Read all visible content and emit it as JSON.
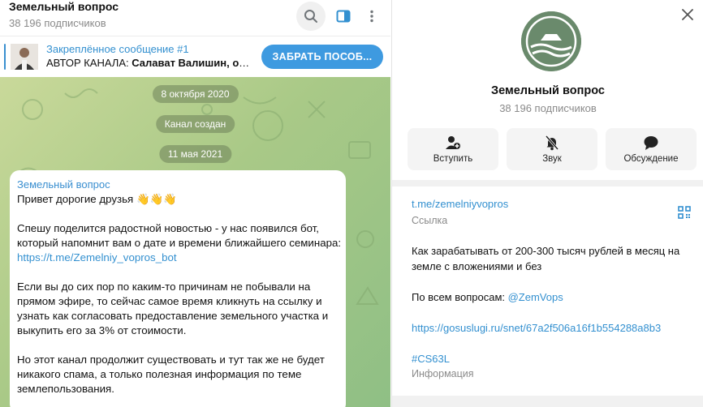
{
  "header": {
    "title": "Земельный вопрос",
    "subscribers": "38 196 подписчиков"
  },
  "pinned": {
    "title": "Закреплённое сообщение #1",
    "text_prefix": "АВТОР КАНАЛА:",
    "text_rest": " Салават Валишин, ос...",
    "button": "ЗАБРАТЬ ПОСОБ..."
  },
  "chat": {
    "dates": [
      "8 октября 2020",
      "Канал создан",
      "11 мая 2021"
    ],
    "message": {
      "sender": "Земельный вопрос",
      "greeting": "Привет дорогие друзья",
      "greeting_emoji": "👋👋👋",
      "p2_text": "Спешу поделится радостной новостью - у нас появился бот, который напомнит вам о дате и времени ближайшего семинара: ",
      "p2_link": "https://t.me/Zemelniy_vopros_bot",
      "p3": "Если вы до сих пор по каким-то причинам не побывали на прямом эфире, то сейчас самое время кликнуть на ссылку и узнать как согласовать предоставление земельного участка и выкупить его за 3% от стоимости.",
      "p4": "Но этот канал продолжит существовать и тут так же не будет никакого спама, а только полезная информация по теме землепользования."
    }
  },
  "panel": {
    "title": "Земельный вопрос",
    "subscribers": "38 196 подписчиков",
    "actions": [
      {
        "label": "Вступить",
        "icon": "add-user-icon"
      },
      {
        "label": "Звук",
        "icon": "bell-muted-icon"
      },
      {
        "label": "Обсуждение",
        "icon": "chat-bubble-icon"
      }
    ],
    "link": "t.me/zemelniyvopros",
    "link_label": "Ссылка",
    "desc1": "Как зарабатывать от 200-300 тысяч рублей в месяц на земле с вложениями и без",
    "desc2_text": "По всем вопросам: ",
    "desc2_link": "@ZemVops",
    "desc3_link": "https://gosuslugi.ru/snet/67a2f506a16f1b554288a8b3",
    "desc4_link": "#CS63L",
    "info_label": "Информация"
  },
  "colors": {
    "accent": "#3390d0",
    "button": "#3e9ae0",
    "chat_bg_start": "#c9d99a",
    "chat_bg_end": "#8fbf85",
    "avatar_bg": "#6a8a6c"
  }
}
